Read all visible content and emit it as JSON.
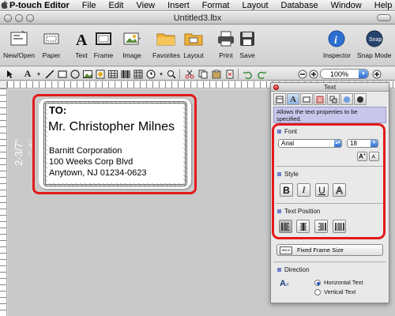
{
  "menubar": {
    "apple": "",
    "items": [
      "P-touch Editor",
      "File",
      "Edit",
      "View",
      "Insert",
      "Format",
      "Layout",
      "Database",
      "Window",
      "Help"
    ]
  },
  "window": {
    "title": "Untitled3.lbx"
  },
  "toolbar": {
    "new_open": "New/Open",
    "paper": "Paper",
    "text": "Text",
    "frame": "Frame",
    "image": "Image",
    "favorites": "Favorites",
    "layout": "Layout",
    "print": "Print",
    "save": "Save",
    "inspector": "Inspector",
    "snap_mode": "Snap Mode"
  },
  "toolbar2": {
    "zoom": "100%"
  },
  "canvas": {
    "tape_width": "2-3/7\"",
    "tape_width_ghost": "\" 4\"",
    "label": {
      "to": "TO:",
      "name": "Mr. Christopher Milnes",
      "company": "Barnitt Corporation",
      "street": "100 Weeks Corp Blvd",
      "city": "Anytown, NJ 01234-0623"
    }
  },
  "inspector": {
    "title": "Text",
    "tab_text_glyph": "A",
    "description": "Allows the text properties to be specified.",
    "font_header": "Font",
    "font_value": "Arial",
    "size_value": "18",
    "style_header": "Style",
    "bold": "B",
    "italic": "I",
    "underline": "U",
    "outline": "A",
    "position_header": "Text Position",
    "fixed_frame": "Fixed Frame Size",
    "direction_header": "Direction",
    "horizontal": "Horizontal Text",
    "vertical": "Vertical Text"
  },
  "colors": {
    "highlight": "#e21a1a",
    "description_bg": "#c9c6ec",
    "accent_blue": "#2e6dd0"
  }
}
